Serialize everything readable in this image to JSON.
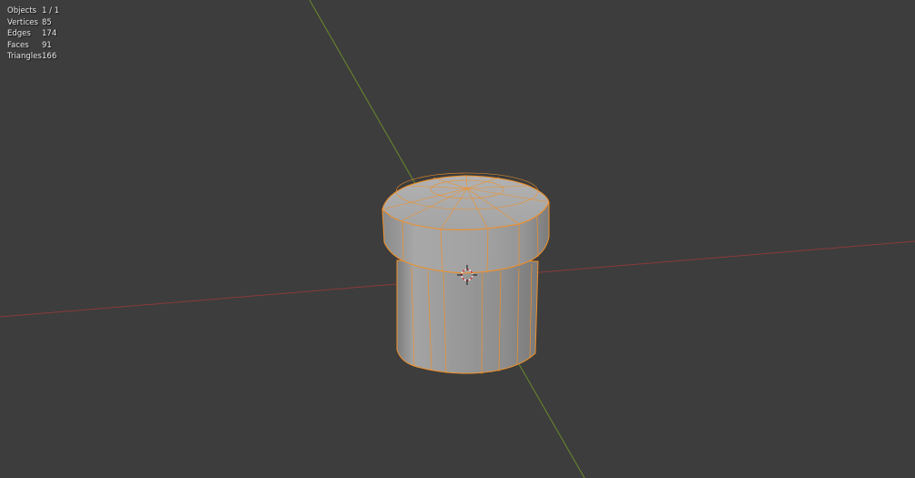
{
  "viewport": {
    "background_color": "#3d3d3d",
    "x_axis_color": "#8a3a3a",
    "y_axis_color": "#6a8a2a",
    "selection_outline_color": "#f0902a"
  },
  "statistics": {
    "rows": [
      {
        "label": "Objects",
        "value": "1 / 1"
      },
      {
        "label": "Vertices",
        "value": "85"
      },
      {
        "label": "Edges",
        "value": "174"
      },
      {
        "label": "Faces",
        "value": "91"
      },
      {
        "label": "Triangles",
        "value": "166"
      }
    ]
  },
  "scene": {
    "object_icon": "cylinder-mesh-object",
    "cursor_icon": "3d-cursor-icon"
  }
}
